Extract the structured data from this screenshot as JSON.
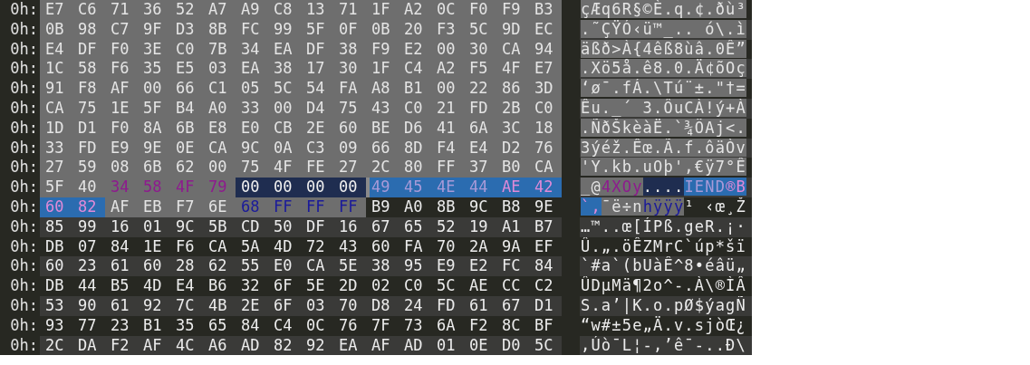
{
  "rows": [
    {
      "offset": "0h:",
      "hex": [
        {
          "kind": "sel",
          "bytes": [
            "E7",
            "C6",
            "71",
            "36",
            "52",
            "A7",
            "A9",
            "C8",
            "13",
            "71",
            "1F",
            "A2",
            "0C",
            "F0",
            "F9",
            "B3"
          ]
        }
      ],
      "ascii": [
        {
          "kind": "sel",
          "text": "çÆq6R§©È.q.¢.ðù³"
        }
      ]
    },
    {
      "offset": "0h:",
      "hex": [
        {
          "kind": "sel",
          "bytes": [
            "0B",
            "98",
            "C7",
            "9F",
            "D3",
            "8B",
            "FC",
            "99",
            "5F",
            "0F",
            "0B",
            "20",
            "F3",
            "5C",
            "9D",
            "EC"
          ]
        }
      ],
      "ascii": [
        {
          "kind": "sel",
          "text": ".˜ÇŸÓ‹ü™_.. ó\\.ì"
        }
      ]
    },
    {
      "offset": "0h:",
      "hex": [
        {
          "kind": "sel",
          "bytes": [
            "E4",
            "DF",
            "F0",
            "3E",
            "C0",
            "7B",
            "34",
            "EA",
            "DF",
            "38",
            "F9",
            "E2",
            "00",
            "30",
            "CA",
            "94"
          ]
        }
      ],
      "ascii": [
        {
          "kind": "sel",
          "text": "äßð>À{4êß8ùâ.0Ê”"
        }
      ]
    },
    {
      "offset": "0h:",
      "hex": [
        {
          "kind": "sel",
          "bytes": [
            "1C",
            "58",
            "F6",
            "35",
            "E5",
            "03",
            "EA",
            "38",
            "17",
            "30",
            "1F",
            "C4",
            "A2",
            "F5",
            "4F",
            "E7"
          ]
        }
      ],
      "ascii": [
        {
          "kind": "sel",
          "text": ".Xö5å.ê8.0.Ä¢õOç"
        }
      ]
    },
    {
      "offset": "0h:",
      "hex": [
        {
          "kind": "sel",
          "bytes": [
            "91",
            "F8",
            "AF",
            "00",
            "66",
            "C1",
            "05",
            "5C",
            "54",
            "FA",
            "A8",
            "B1",
            "00",
            "22",
            "86",
            "3D"
          ]
        }
      ],
      "ascii": [
        {
          "kind": "sel",
          "text": "‘ø¯.fÁ.\\Tú¨±.\"†="
        }
      ]
    },
    {
      "offset": "0h:",
      "hex": [
        {
          "kind": "sel",
          "bytes": [
            "CA",
            "75",
            "1E",
            "5F",
            "B4",
            "A0",
            "33",
            "00",
            "D4",
            "75",
            "43",
            "C0",
            "21",
            "FD",
            "2B",
            "C0"
          ]
        }
      ],
      "ascii": [
        {
          "kind": "sel",
          "text": "Êu._´ 3.ÔuCÀ!ý+À"
        }
      ]
    },
    {
      "offset": "0h:",
      "hex": [
        {
          "kind": "sel",
          "bytes": [
            "1D",
            "D1",
            "F0",
            "8A",
            "6B",
            "E8",
            "E0",
            "CB",
            "2E",
            "60",
            "BE",
            "D6",
            "41",
            "6A",
            "3C",
            "18"
          ]
        }
      ],
      "ascii": [
        {
          "kind": "sel",
          "text": ".ÑðŠkèàË.`¾ÖAj<."
        }
      ]
    },
    {
      "offset": "0h:",
      "hex": [
        {
          "kind": "sel",
          "bytes": [
            "33",
            "FD",
            "E9",
            "9E",
            "0E",
            "CA",
            "9C",
            "0A",
            "C3",
            "09",
            "66",
            "8D",
            "F4",
            "E4",
            "D2",
            "76"
          ]
        }
      ],
      "ascii": [
        {
          "kind": "sel",
          "text": "3ýéž.Êœ.Ã.f.ôäÒv"
        }
      ]
    },
    {
      "offset": "0h:",
      "hex": [
        {
          "kind": "sel",
          "bytes": [
            "27",
            "59",
            "08",
            "6B",
            "62",
            "00",
            "75",
            "4F",
            "FE",
            "27",
            "2C",
            "80",
            "FF",
            "37",
            "B0",
            "CA"
          ]
        }
      ],
      "ascii": [
        {
          "kind": "sel",
          "text": "'Y.kb.uOþ',€ÿ7°Ê"
        }
      ]
    },
    {
      "offset": "0h:",
      "hex": [
        {
          "kind": "sel",
          "bytes": [
            "5F",
            "40"
          ]
        },
        {
          "kind": "sel-purple",
          "bytes": [
            "34",
            "58",
            "4F",
            "79"
          ]
        },
        {
          "kind": "navy",
          "bytes": [
            "00",
            "00",
            "00",
            "00"
          ]
        },
        {
          "kind": "blue",
          "cursor": true,
          "bytes": [
            "49",
            "45",
            "4E",
            "44"
          ]
        },
        {
          "kind": "blue-pink",
          "bytes": [
            "AE",
            "42"
          ]
        }
      ],
      "ascii": [
        {
          "kind": "sel",
          "text": "_@"
        },
        {
          "kind": "sel-purple",
          "text": "4XOy"
        },
        {
          "kind": "navy",
          "text": "...."
        },
        {
          "kind": "blue",
          "text": "IEND"
        },
        {
          "kind": "blue-pink",
          "text": "®B"
        }
      ]
    },
    {
      "offset": "0h:",
      "hex": [
        {
          "kind": "blue-pink",
          "bytes": [
            "60",
            "82"
          ]
        },
        {
          "kind": "sel",
          "bytes": [
            "AF",
            "EB",
            "F7",
            "6E"
          ]
        },
        {
          "kind": "sel-navy-text",
          "bytes": [
            "68",
            "FF",
            "FF",
            "FF"
          ]
        },
        {
          "kind": "plain",
          "bytes": [
            "B9",
            "A0",
            "8B",
            "9C",
            "B8",
            "9E"
          ]
        }
      ],
      "ascii": [
        {
          "kind": "blue-pink",
          "text": "`,"
        },
        {
          "kind": "sel",
          "text": "¯ë÷n"
        },
        {
          "kind": "sel-navy-text",
          "text": "hÿÿÿ"
        },
        {
          "kind": "plain",
          "text": "¹ ‹œ¸Ž"
        }
      ]
    },
    {
      "offset": "0h:",
      "hex": [
        {
          "kind": "plain",
          "bytes": [
            "85",
            "99",
            "16",
            "01",
            "9C",
            "5B",
            "CD",
            "50",
            "DF",
            "16",
            "67",
            "65",
            "52",
            "19",
            "A1",
            "B7"
          ]
        }
      ],
      "ascii": [
        {
          "kind": "plain",
          "text": "…™..œ[ÍPß.geR.¡·"
        }
      ]
    },
    {
      "offset": "0h:",
      "hex": [
        {
          "kind": "plain",
          "bytes": [
            "DB",
            "07",
            "84",
            "1E",
            "F6",
            "CA",
            "5A",
            "4D",
            "72",
            "43",
            "60",
            "FA",
            "70",
            "2A",
            "9A",
            "EF"
          ]
        }
      ],
      "ascii": [
        {
          "kind": "plain",
          "text": "Û.„.öÊZMrC`úp*šï"
        }
      ]
    },
    {
      "offset": "0h:",
      "hex": [
        {
          "kind": "plain",
          "bytes": [
            "60",
            "23",
            "61",
            "60",
            "28",
            "62",
            "55",
            "E0",
            "CA",
            "5E",
            "38",
            "95",
            "E9",
            "E2",
            "FC",
            "84"
          ]
        }
      ],
      "ascii": [
        {
          "kind": "plain",
          "text": "`#a`(bUàÊ^8•éâü„"
        }
      ]
    },
    {
      "offset": "0h:",
      "hex": [
        {
          "kind": "plain",
          "bytes": [
            "DB",
            "44",
            "B5",
            "4D",
            "E4",
            "B6",
            "32",
            "6F",
            "5E",
            "2D",
            "02",
            "C0",
            "5C",
            "AE",
            "CC",
            "C2"
          ]
        }
      ],
      "ascii": [
        {
          "kind": "plain",
          "text": "ÛDµMä¶2o^-.À\\®ÌÂ"
        }
      ]
    },
    {
      "offset": "0h:",
      "hex": [
        {
          "kind": "plain",
          "bytes": [
            "53",
            "90",
            "61",
            "92",
            "7C",
            "4B",
            "2E",
            "6F",
            "03",
            "70",
            "D8",
            "24",
            "FD",
            "61",
            "67",
            "D1"
          ]
        }
      ],
      "ascii": [
        {
          "kind": "plain",
          "text": "S.a’|K.o.pØ$ýagÑ"
        }
      ]
    },
    {
      "offset": "0h:",
      "hex": [
        {
          "kind": "plain",
          "bytes": [
            "93",
            "77",
            "23",
            "B1",
            "35",
            "65",
            "84",
            "C4",
            "0C",
            "76",
            "7F",
            "73",
            "6A",
            "F2",
            "8C",
            "BF"
          ]
        }
      ],
      "ascii": [
        {
          "kind": "plain",
          "text": "“w#±5e„Ä.v.sjòŒ¿"
        }
      ]
    },
    {
      "offset": "0h:",
      "hex": [
        {
          "kind": "plain",
          "bytes": [
            "2C",
            "DA",
            "F2",
            "AF",
            "4C",
            "A6",
            "AD",
            "82",
            "92",
            "EA",
            "AF",
            "AD",
            "01",
            "0E",
            "D0",
            "5C"
          ]
        }
      ],
      "ascii": [
        {
          "kind": "plain",
          "text": ",Úò¯L¦-‚’ê¯-..Ð\\"
        }
      ]
    }
  ]
}
